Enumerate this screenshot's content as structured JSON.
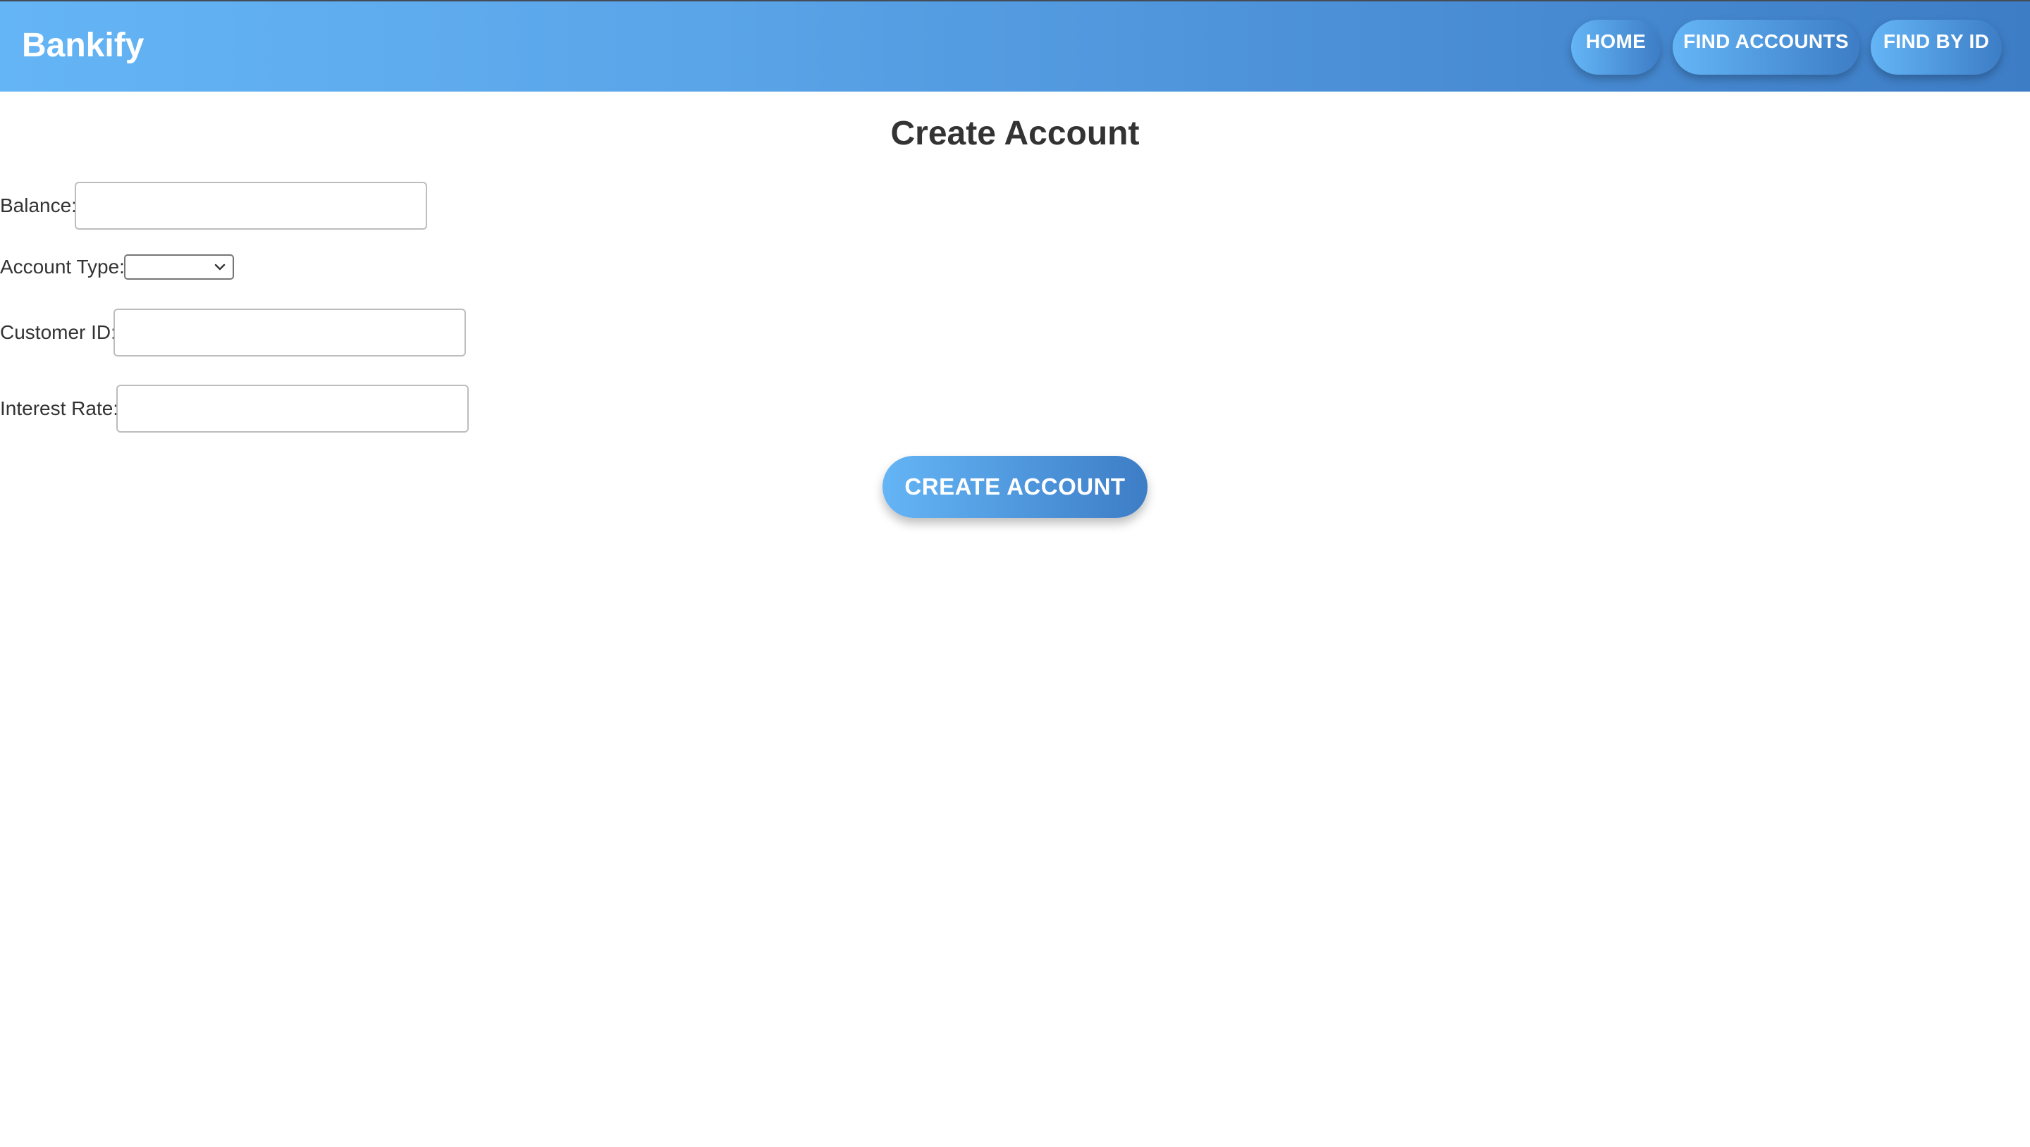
{
  "navbar": {
    "brand": "Bankify",
    "links": [
      {
        "label": "HOME"
      },
      {
        "label": "FIND ACCOUNTS"
      },
      {
        "label": "FIND BY ID"
      }
    ]
  },
  "form": {
    "title": "Create Account",
    "fields": {
      "balance": {
        "label": "Balance:",
        "value": ""
      },
      "account_type": {
        "label": "Account Type:",
        "selected": ""
      },
      "customer_id": {
        "label": "Customer ID:",
        "value": ""
      },
      "interest_rate": {
        "label": "Interest Rate:",
        "value": ""
      }
    },
    "submit_label": "CREATE ACCOUNT"
  },
  "colors": {
    "accent_start": "#64b5f6",
    "accent_end": "#3d7dc6",
    "text": "#333333"
  }
}
